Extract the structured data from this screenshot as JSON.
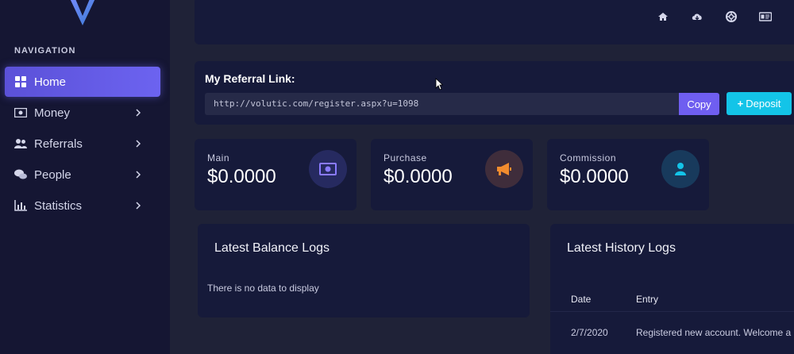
{
  "sidebar": {
    "heading": "NAVIGATION",
    "items": [
      {
        "label": "Home",
        "icon": "grid-icon",
        "active": true
      },
      {
        "label": "Money",
        "icon": "banknote-icon"
      },
      {
        "label": "Referrals",
        "icon": "users-icon"
      },
      {
        "label": "People",
        "icon": "chat-bubbles-icon"
      },
      {
        "label": "Statistics",
        "icon": "bar-chart-icon"
      }
    ]
  },
  "topbar": {
    "icons": [
      "home-icon",
      "cloud-download-icon",
      "lifebuoy-icon",
      "id-card-icon"
    ]
  },
  "referral": {
    "title": "My Referral Link:",
    "link": "http://volutic.com/register.aspx?u=1098",
    "copy_label": "Copy",
    "deposit_label": "Deposit"
  },
  "stats": [
    {
      "label": "Main",
      "value": "$0.0000",
      "icon": "banknote-icon",
      "color": "#6f5ef0"
    },
    {
      "label": "Purchase",
      "value": "$0.0000",
      "icon": "megaphone-icon",
      "color": "#f28c2e"
    },
    {
      "label": "Commission",
      "value": "$0.0000",
      "icon": "user-icon",
      "color": "#13c4e8"
    }
  ],
  "balance_logs": {
    "title": "Latest Balance Logs",
    "empty_text": "There is no data to display"
  },
  "history_logs": {
    "title": "Latest History Logs",
    "headers": {
      "date": "Date",
      "entry": "Entry"
    },
    "rows": [
      {
        "date": "2/7/2020",
        "entry": "Registered new account. Welcome a"
      }
    ]
  },
  "colors": {
    "background": "#1f2237",
    "sidebar": "#151633",
    "card": "#161a3a",
    "accent_purple": "#6f5ef0",
    "accent_cyan": "#13c4e8"
  }
}
